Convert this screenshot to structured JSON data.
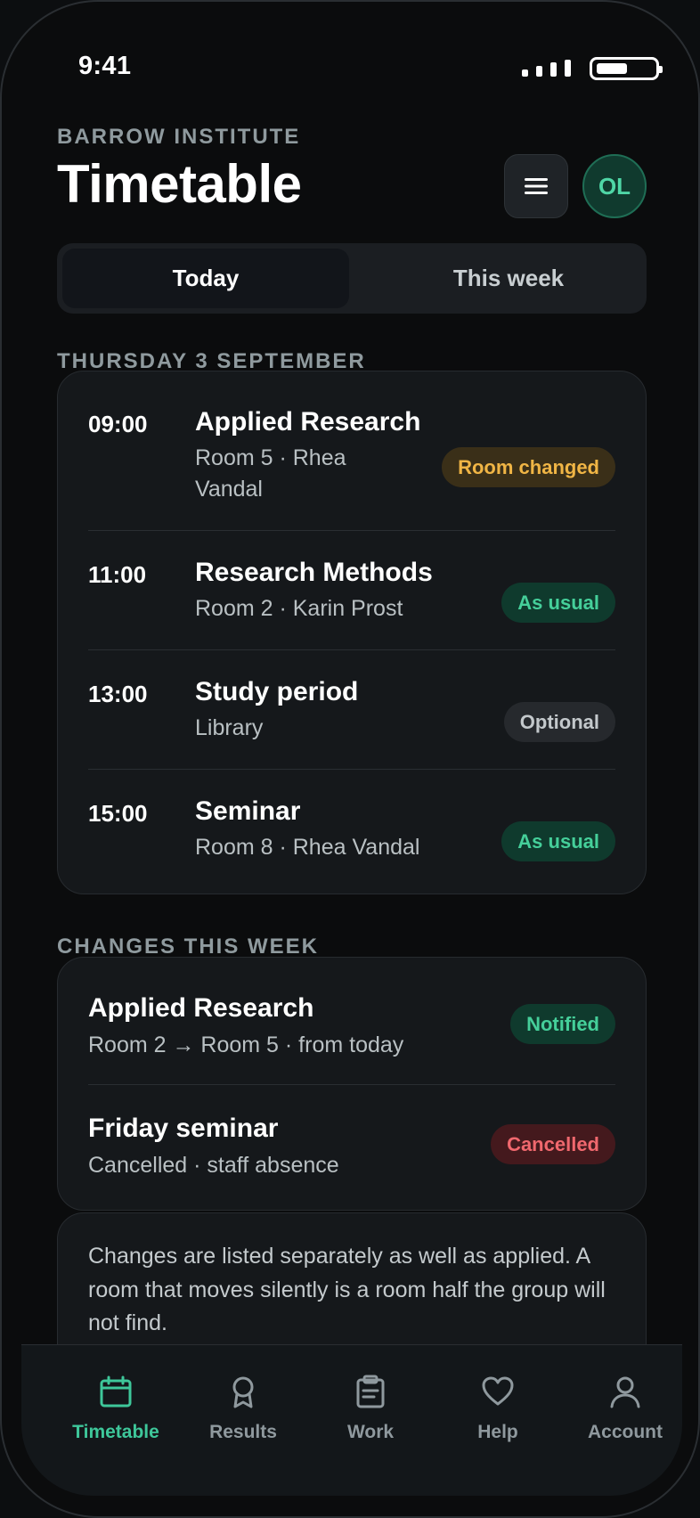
{
  "status_bar": {
    "time": "9:41"
  },
  "header": {
    "eyebrow": "BARROW INSTITUTE",
    "title": "Timetable",
    "avatar_initials": "OL"
  },
  "segmented": {
    "options": [
      "Today",
      "This week"
    ],
    "selected": "Today"
  },
  "today": {
    "section_label": "THURSDAY 3 SEPTEMBER",
    "rows": [
      {
        "time": "09:00",
        "title": "Applied Research",
        "sub_line1": "Room 5 · Rhea",
        "sub_line2": "Vandal",
        "badge": "Room changed",
        "badge_tone": "amber"
      },
      {
        "time": "11:00",
        "title": "Research Methods",
        "sub_line1": "Room 2 · Karin Prost",
        "badge": "As usual",
        "badge_tone": "green"
      },
      {
        "time": "13:00",
        "title": "Study period",
        "sub_line1": "Library",
        "badge": "Optional",
        "badge_tone": "grey"
      },
      {
        "time": "15:00",
        "title": "Seminar",
        "sub_line1": "Room 8 · Rhea Vandal",
        "badge": "As usual",
        "badge_tone": "green"
      }
    ]
  },
  "changes": {
    "section_label": "CHANGES THIS WEEK",
    "items": [
      {
        "title": "Applied Research",
        "sub": "Room 2 → Room 5 · from today",
        "badge": "Notified",
        "badge_tone": "green"
      },
      {
        "title": "Friday seminar",
        "sub": "Cancelled · staff absence",
        "badge": "Cancelled",
        "badge_tone": "red"
      }
    ]
  },
  "note": {
    "text": "Changes are listed separately as well as applied. A room that moves silently is a room half the group will not find."
  },
  "tabbar": {
    "tabs": [
      {
        "label": "Timetable",
        "icon": "calendar-icon",
        "active": true
      },
      {
        "label": "Results",
        "icon": "award-icon",
        "active": false
      },
      {
        "label": "Work",
        "icon": "clipboard-icon",
        "active": false
      },
      {
        "label": "Help",
        "icon": "heart-icon",
        "active": false
      },
      {
        "label": "Account",
        "icon": "person-icon",
        "active": false
      }
    ]
  },
  "colors": {
    "accent": "#3ec79a",
    "amber": "#f0b545",
    "danger": "#f0686e",
    "background": "#0b0c0d"
  }
}
